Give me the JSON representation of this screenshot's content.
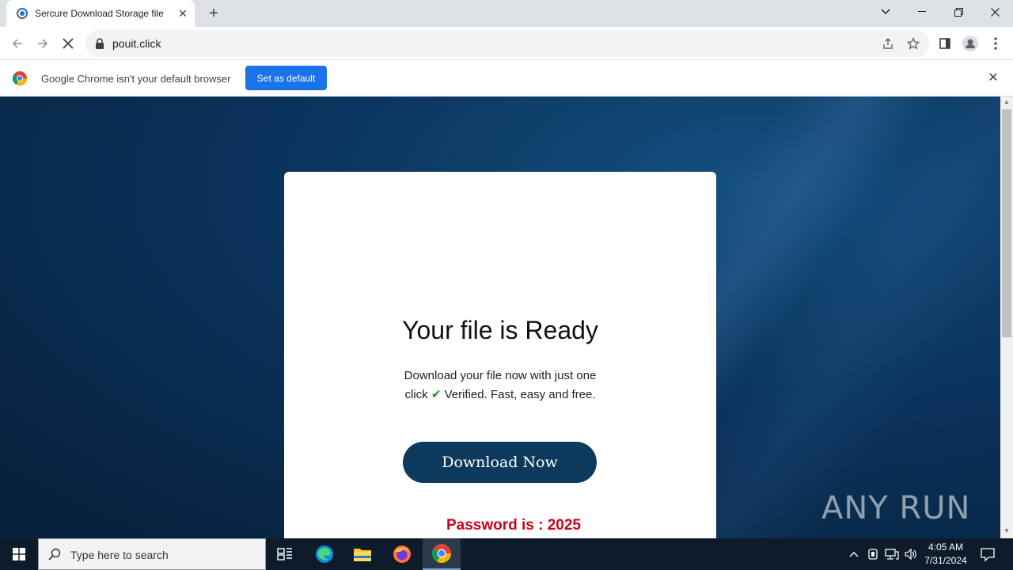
{
  "browser": {
    "tab": {
      "title": "Sercure Download Storage file"
    },
    "url": "pouit.click"
  },
  "infobar": {
    "message": "Google Chrome isn't your default browser",
    "button_label": "Set as default"
  },
  "page": {
    "title": "Your file is Ready",
    "desc_line1": "Download your file now with just one",
    "desc_click": "click",
    "desc_check": "✔",
    "desc_line2": "Verified. Fast, easy and free.",
    "download_label": "Download Now",
    "password": "Password is : 2025"
  },
  "watermark": "ANY RUN",
  "taskbar": {
    "search_placeholder": "Type here to search",
    "time": "4:05 AM",
    "date": "7/31/2024"
  },
  "colors": {
    "accent_button": "#1a73e8",
    "download_button": "#0d3a5c",
    "password_text": "#d0021b"
  }
}
